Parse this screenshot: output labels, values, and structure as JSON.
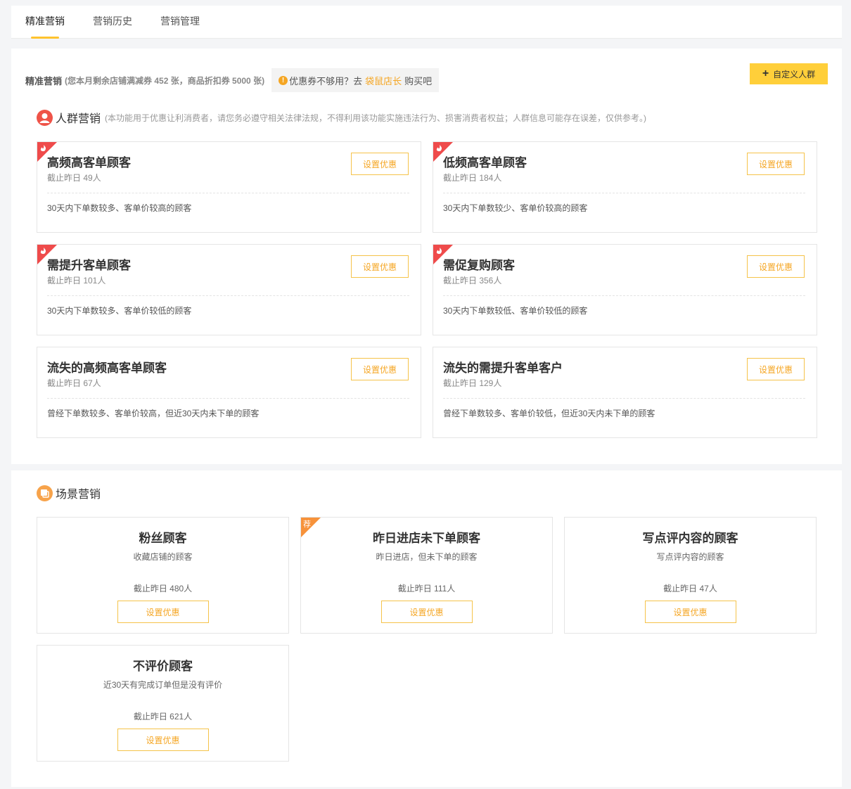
{
  "tabs": [
    {
      "label": "精准营销",
      "active": true
    },
    {
      "label": "营销历史",
      "active": false
    },
    {
      "label": "营销管理",
      "active": false
    }
  ],
  "precise": {
    "title": "精准营销",
    "note": "(您本月剩余店铺满减券 452 张，商品折扣券 5000 张)",
    "tip_prefix": "优惠券不够用？去",
    "tip_link": "袋鼠店长",
    "tip_suffix": "购买吧",
    "warn_icon": "!"
  },
  "custom_button": {
    "plus": "+",
    "label": "自定义人群"
  },
  "crowd": {
    "title": "人群营销",
    "desc": "(本功能用于优惠让利消费者，请您务必遵守相关法律法规，不得利用该功能实施违法行为、损害消费者权益；人群信息可能存在误差，仅供参考。)",
    "cards": [
      {
        "title": "高频高客单顾客",
        "count": "截止昨日 49人",
        "desc": "30天内下单数较多、客单价较高的顾客",
        "hot": true,
        "button": "设置优惠"
      },
      {
        "title": "低频高客单顾客",
        "count": "截止昨日 184人",
        "desc": "30天内下单数较少、客单价较高的顾客",
        "hot": true,
        "button": "设置优惠"
      },
      {
        "title": "需提升客单顾客",
        "count": "截止昨日 101人",
        "desc": "30天内下单数较多、客单价较低的顾客",
        "hot": true,
        "button": "设置优惠"
      },
      {
        "title": "需促复购顾客",
        "count": "截止昨日 356人",
        "desc": "30天内下单数较低、客单价较低的顾客",
        "hot": true,
        "button": "设置优惠"
      },
      {
        "title": "流失的高频高客单顾客",
        "count": "截止昨日 67人",
        "desc": "曾经下单数较多、客单价较高，但近30天内未下单的顾客",
        "hot": false,
        "button": "设置优惠"
      },
      {
        "title": "流失的需提升客单客户",
        "count": "截止昨日 129人",
        "desc": "曾经下单数较多、客单价较低，但近30天内未下单的顾客",
        "hot": false,
        "button": "设置优惠"
      }
    ]
  },
  "scene": {
    "title": "场景营销",
    "rec_label": "荐",
    "cards": [
      {
        "title": "粉丝顾客",
        "desc": "收藏店铺的顾客",
        "count": "截止昨日 480人",
        "rec": false,
        "button": "设置优惠"
      },
      {
        "title": "昨日进店未下单顾客",
        "desc": "昨日进店，但未下单的顾客",
        "count": "截止昨日 111人",
        "rec": true,
        "button": "设置优惠"
      },
      {
        "title": "写点评内容的顾客",
        "desc": "写点评内容的顾客",
        "count": "截止昨日 47人",
        "rec": false,
        "button": "设置优惠"
      },
      {
        "title": "不评价顾客",
        "desc": "近30天有完成订单但是没有评价",
        "count": "截止昨日 621人",
        "rec": false,
        "button": "设置优惠"
      }
    ]
  },
  "colors": {
    "accent": "#ffcf3a",
    "link": "#f5a623",
    "hot": "#ef4b4b",
    "rec": "#f7923a"
  }
}
